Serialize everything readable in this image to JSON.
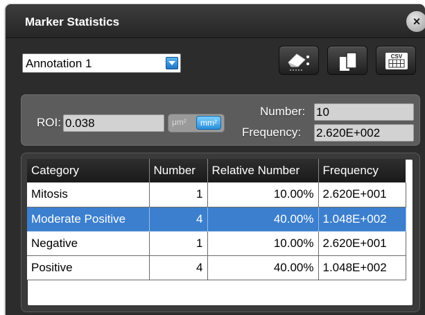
{
  "window": {
    "title": "Marker Statistics",
    "close_glyph": "×"
  },
  "toolbar": {
    "annotation_select": {
      "value": "Annotation 1"
    },
    "buttons": [
      {
        "name": "eraser-icon"
      },
      {
        "name": "copy-icon"
      },
      {
        "name": "csv-export-icon",
        "label": "CSV"
      }
    ]
  },
  "stats": {
    "roi_label": "ROI:",
    "roi_value": "0.038",
    "unit_um": "μm²",
    "unit_mm": "mm²",
    "number_label": "Number:",
    "number_value": "10",
    "frequency_label": "Frequency:",
    "frequency_value": "2.620E+002"
  },
  "table": {
    "columns": [
      "Category",
      "Number",
      "Relative Number",
      "Frequency"
    ],
    "rows": [
      {
        "category": "Mitosis",
        "number": "1",
        "relative": "10.00%",
        "frequency": "2.620E+001",
        "selected": false
      },
      {
        "category": "Moderate Positive",
        "number": "4",
        "relative": "40.00%",
        "frequency": "1.048E+002",
        "selected": true
      },
      {
        "category": "Negative",
        "number": "1",
        "relative": "10.00%",
        "frequency": "2.620E+001",
        "selected": false
      },
      {
        "category": "Positive",
        "number": "4",
        "relative": "40.00%",
        "frequency": "1.048E+002",
        "selected": false
      }
    ]
  },
  "colors": {
    "accent": "#3b7fce",
    "toggle_active": "#2a8fd9",
    "window_bg": "#2c2c2c"
  }
}
